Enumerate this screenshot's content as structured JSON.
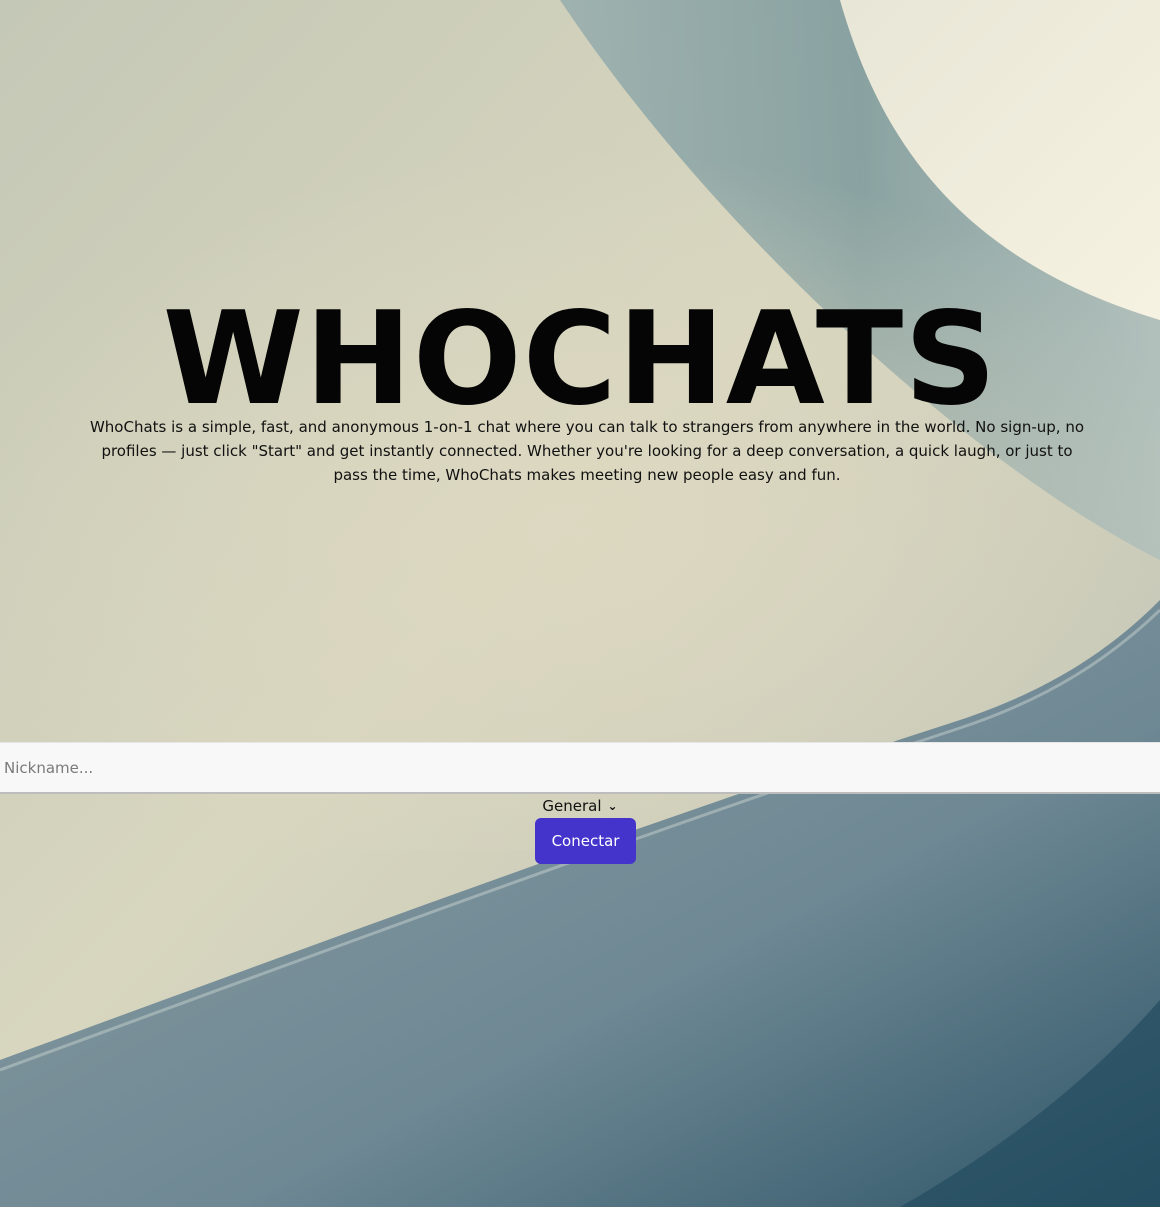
{
  "hero": {
    "title": "WHOCHATS",
    "description": "WhoChats is a simple, fast, and anonymous 1-on-1 chat where you can talk to strangers from anywhere in the world. No sign-up, no profiles — just click \"Start\" and get instantly connected. Whether you're looking for a deep conversation, a quick laugh, or just to pass the time, WhoChats makes meeting new people easy and fun."
  },
  "form": {
    "nickname_placeholder": "Nickname...",
    "room_selected": "General",
    "connect_label": "Conectar"
  },
  "colors": {
    "accent": "#4434cc",
    "title": "#050505"
  }
}
